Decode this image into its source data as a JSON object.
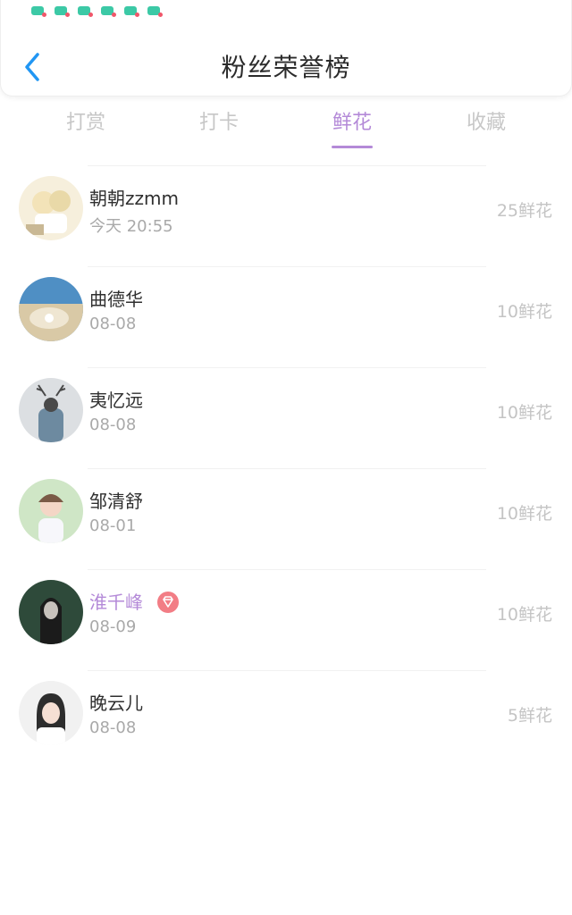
{
  "header": {
    "title": "粉丝荣誉榜"
  },
  "tabs": [
    {
      "label": "打赏",
      "active": false
    },
    {
      "label": "打卡",
      "active": false
    },
    {
      "label": "鲜花",
      "active": true
    },
    {
      "label": "收藏",
      "active": false
    }
  ],
  "fans": [
    {
      "name": "朝朝zzmm",
      "date": "今天 20:55",
      "amount": "25鲜花",
      "vip": false
    },
    {
      "name": "曲德华",
      "date": "08-08",
      "amount": "10鲜花",
      "vip": false
    },
    {
      "name": "夷忆远",
      "date": "08-08",
      "amount": "10鲜花",
      "vip": false
    },
    {
      "name": "邹清舒",
      "date": "08-01",
      "amount": "10鲜花",
      "vip": false
    },
    {
      "name": "淮千峰",
      "date": "08-09",
      "amount": "10鲜花",
      "vip": true
    },
    {
      "name": "晚云儿",
      "date": "08-08",
      "amount": "5鲜花",
      "vip": false
    }
  ],
  "colors": {
    "accent": "#b48ad8",
    "back_arrow": "#2196f3",
    "vip_badge": "#f27d85",
    "notification_icon": "#3cc9a6"
  },
  "icons": {
    "back": "chevron-left-icon",
    "vip": "diamond-icon",
    "status": "app-notification-icon"
  }
}
